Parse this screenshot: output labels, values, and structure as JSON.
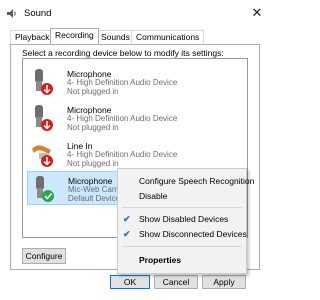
{
  "window": {
    "title": "Sound",
    "close_glyph": "✕"
  },
  "tabs": [
    {
      "label": "Playback",
      "active": false
    },
    {
      "label": "Recording",
      "active": true
    },
    {
      "label": "Sounds",
      "active": false
    },
    {
      "label": "Communications",
      "active": false
    }
  ],
  "instruction": "Select a recording device below to modify its settings:",
  "devices": [
    {
      "name": "Microphone",
      "device": "4- High Definition Audio Device",
      "status": "Not plugged in",
      "icon": "microphone-icon",
      "status_icon": "down-arrow-red-icon"
    },
    {
      "name": "Microphone",
      "device": "4- High Definition Audio Device",
      "status": "Not plugged in",
      "icon": "microphone-icon",
      "status_icon": "down-arrow-red-icon"
    },
    {
      "name": "Line In",
      "device": "4- High Definition Audio Device",
      "status": "Not plugged in",
      "icon": "line-in-jack-icon",
      "status_icon": "down-arrow-red-icon"
    },
    {
      "name": "Microphone",
      "device": "Mic-Web Camera",
      "status": "Default Device",
      "icon": "microphone-icon",
      "status_icon": "green-check-icon",
      "selected": true
    }
  ],
  "buttons": {
    "configure": "Configure",
    "ok": "OK",
    "cancel": "Cancel",
    "apply": "Apply"
  },
  "context_menu": {
    "items": [
      {
        "label": "Configure Speech Recognition",
        "checked": false
      },
      {
        "label": "Disable",
        "checked": false
      },
      {
        "label": "Show Disabled Devices",
        "checked": true
      },
      {
        "label": "Show Disconnected Devices",
        "checked": true
      },
      {
        "label": "Properties",
        "checked": false,
        "bold": true
      }
    ]
  },
  "colors": {
    "selection": "#cce8ff",
    "check": "#1f6fd0",
    "status_red": "#d4201d",
    "status_green": "#2da44e"
  }
}
